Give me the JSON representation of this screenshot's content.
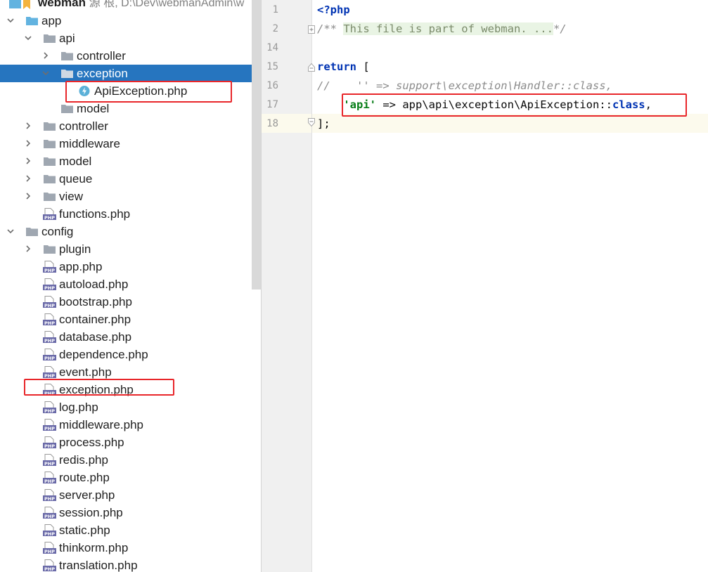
{
  "tree": {
    "root": {
      "name": "webman",
      "path": "源 根, D:\\Dev\\webmanAdmin\\w"
    },
    "items": [
      {
        "label": "app",
        "type": "folder-blue",
        "chevron": "down"
      },
      {
        "label": "api",
        "type": "folder",
        "chevron": "down"
      },
      {
        "label": "controller",
        "type": "folder",
        "chevron": "right"
      },
      {
        "label": "exception",
        "type": "folder",
        "chevron": "down",
        "selected": true
      },
      {
        "label": "ApiException.php",
        "type": "php-class"
      },
      {
        "label": "model",
        "type": "folder"
      },
      {
        "label": "controller",
        "type": "folder",
        "chevron": "right"
      },
      {
        "label": "middleware",
        "type": "folder",
        "chevron": "right"
      },
      {
        "label": "model",
        "type": "folder",
        "chevron": "right"
      },
      {
        "label": "queue",
        "type": "folder",
        "chevron": "right"
      },
      {
        "label": "view",
        "type": "folder",
        "chevron": "right"
      },
      {
        "label": "functions.php",
        "type": "php-file"
      },
      {
        "label": "config",
        "type": "folder",
        "chevron": "down"
      },
      {
        "label": "plugin",
        "type": "folder",
        "chevron": "right"
      },
      {
        "label": "app.php",
        "type": "php-file"
      },
      {
        "label": "autoload.php",
        "type": "php-file"
      },
      {
        "label": "bootstrap.php",
        "type": "php-file"
      },
      {
        "label": "container.php",
        "type": "php-file"
      },
      {
        "label": "database.php",
        "type": "php-file"
      },
      {
        "label": "dependence.php",
        "type": "php-file"
      },
      {
        "label": "event.php",
        "type": "php-file"
      },
      {
        "label": "exception.php",
        "type": "php-file"
      },
      {
        "label": "log.php",
        "type": "php-file"
      },
      {
        "label": "middleware.php",
        "type": "php-file"
      },
      {
        "label": "process.php",
        "type": "php-file"
      },
      {
        "label": "redis.php",
        "type": "php-file"
      },
      {
        "label": "route.php",
        "type": "php-file"
      },
      {
        "label": "server.php",
        "type": "php-file"
      },
      {
        "label": "session.php",
        "type": "php-file"
      },
      {
        "label": "static.php",
        "type": "php-file"
      },
      {
        "label": "thinkorm.php",
        "type": "php-file"
      },
      {
        "label": "translation.php",
        "type": "php-file"
      }
    ]
  },
  "editor": {
    "lines": [
      {
        "number": "1",
        "text": "<?php"
      },
      {
        "number": "2",
        "prefix": "/** ",
        "folded": "This file is part of webman. ...",
        "suffix": "*/"
      },
      {
        "number": "14",
        "text": ""
      },
      {
        "number": "15",
        "keyword": "return",
        "rest": " ["
      },
      {
        "number": "16",
        "comment": "//    '' => support\\exception\\Handler::class,"
      },
      {
        "number": "17",
        "indent": "    ",
        "string": "'api'",
        "middle": " => app\\api\\exception\\ApiException::",
        "keyword": "class",
        "end": ","
      },
      {
        "number": "18",
        "text": "];"
      }
    ]
  },
  "icon_names": {
    "folder": "folder-icon",
    "php-file": "php-file-icon",
    "php-class": "php-exception-class-icon"
  },
  "colors": {
    "selection": "#2675bf",
    "highlight_box": "#e8262a",
    "keyword": "#0033b3",
    "string": "#067d17"
  }
}
